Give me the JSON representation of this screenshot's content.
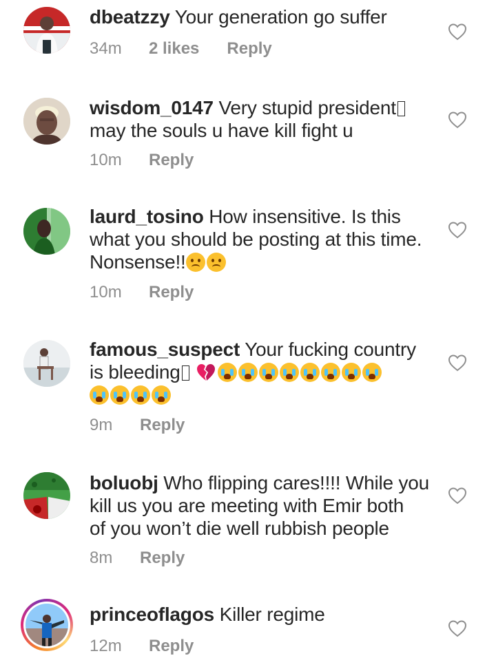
{
  "comments": [
    {
      "username": "dbeatzzy",
      "text": "Your generation go suffer",
      "time": "34m",
      "likes": "2 likes",
      "reply": "Reply",
      "avatar": "user-photo-red-wall"
    },
    {
      "username": "wisdom_0147",
      "text_line1": "Very stupid president",
      "text_line2": "may the souls u have kill fight u",
      "time": "10m",
      "reply": "Reply",
      "avatar": "user-photo-blonde-hair"
    },
    {
      "username": "laurd_tosino",
      "text_line1": "How insensitive. Is this",
      "text_line2": "what you should be posting at this time.",
      "text_line3": "Nonsense!!",
      "time": "10m",
      "reply": "Reply",
      "avatar": "user-photo-green"
    },
    {
      "username": "famous_suspect",
      "text_line1": "Your fucking country",
      "text_line2": "is bleeding",
      "time": "9m",
      "reply": "Reply",
      "avatar": "user-photo-chair"
    },
    {
      "username": "boluobj",
      "text_line1": "Who flipping cares!!!! While you",
      "text_line2": "kill us you are meeting with Emir both",
      "text_line3": "of you won’t die well rubbish people",
      "time": "8m",
      "reply": "Reply",
      "avatar": "flag-photo-green-red"
    },
    {
      "username": "princeoflagos",
      "text": "Killer regime",
      "time": "12m",
      "reply": "Reply",
      "avatar": "user-photo-story-ring"
    }
  ],
  "icons": {
    "like": "heart-outline-icon",
    "crying": "loudly-crying-face-emoji",
    "frowning": "frowning-face-emoji",
    "broken_heart": "broken-heart-emoji",
    "missing_glyph": "missing-glyph-box"
  },
  "colors": {
    "text": "#262626",
    "meta": "#8e8e8e",
    "emoji": "#fbc02d",
    "broken_heart": "#e91e63"
  }
}
